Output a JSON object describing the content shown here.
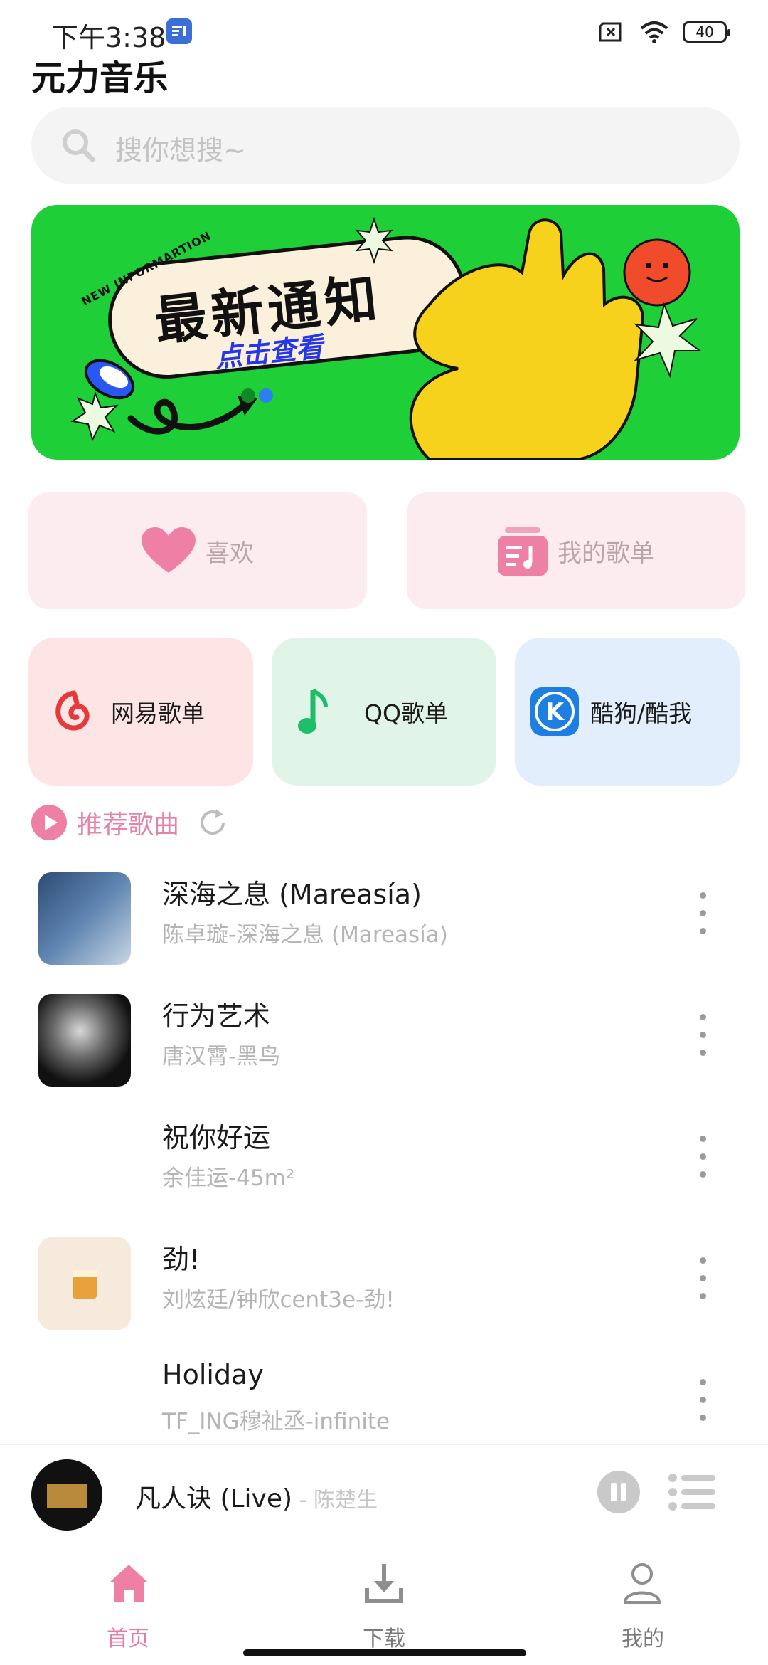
{
  "status_bar": {
    "time": "下午3:38",
    "battery": "40"
  },
  "app": {
    "title": "元力音乐"
  },
  "search": {
    "placeholder": "搜你想搜~"
  },
  "banner": {
    "headline": "最新通知",
    "cta": "点击查看",
    "tag": "NEW INFORMARTION",
    "page_count": 2,
    "active_page": 2
  },
  "quick": [
    {
      "label": "喜欢",
      "icon": "heart-icon"
    },
    {
      "label": "我的歌单",
      "icon": "playlist-icon"
    }
  ],
  "sources": [
    {
      "label": "网易歌单",
      "icon": "netease-music-icon",
      "color": "#e63a3a"
    },
    {
      "label": "QQ歌单",
      "icon": "qq-music-icon",
      "color": "#1ebd6a"
    },
    {
      "label": "酷狗/酷我",
      "icon": "kugou-icon",
      "color": "#1d7fe0"
    }
  ],
  "recommend": {
    "label": "推荐歌曲"
  },
  "songs": [
    {
      "title": "深海之息 (Mareasía)",
      "sub": "陈卓璇-深海之息 (Mareasía)"
    },
    {
      "title": "行为艺术",
      "sub": "唐汉霄-黑鸟"
    },
    {
      "title": "祝你好运",
      "sub": "余佳运-45m²"
    },
    {
      "title": "劲!",
      "sub": "刘炫廷/钟欣cent3e-劲!"
    },
    {
      "title": "Holiday",
      "sub": "TF_ING穆祉丞-infinite"
    }
  ],
  "player": {
    "title": "凡人诀 (Live)",
    "sep": " - ",
    "artist": "陈楚生"
  },
  "tabs": [
    {
      "label": "首页"
    },
    {
      "label": "下载"
    },
    {
      "label": "我的"
    }
  ],
  "colors": {
    "accent": "#e57ca8",
    "banner": "#1fcf37"
  }
}
